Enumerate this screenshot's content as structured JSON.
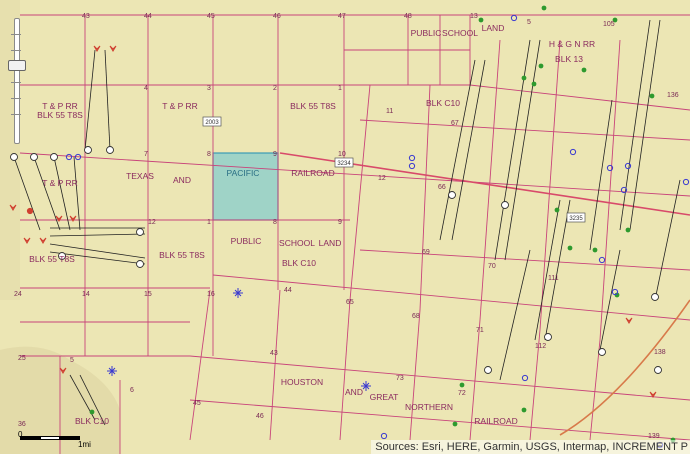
{
  "map": {
    "section_numbers": [
      "43",
      "44",
      "45",
      "46",
      "47",
      "48",
      "13",
      "5",
      "4",
      "3",
      "2",
      "1",
      "11",
      "7",
      "8",
      "9",
      "10",
      "12",
      "12",
      "1",
      "8",
      "9",
      "24",
      "14",
      "15",
      "16",
      "44",
      "25",
      "36",
      "5",
      "6",
      "43",
      "45",
      "46",
      "65",
      "73",
      "72",
      "71",
      "112",
      "111",
      "138",
      "139",
      "105",
      "136",
      "66",
      "67",
      "68",
      "69",
      "70"
    ],
    "labels": [
      "T & P RR",
      "BLK 55 T8S",
      "T & P RR",
      "BLK 55 T8S",
      "BLK C10",
      "PUBLIC",
      "SCHOOL",
      "LAND",
      "H & G N RR",
      "BLK 13",
      "TEXAS",
      "AND",
      "PACIFIC",
      "RAILROAD",
      "T & P RR",
      "BLK 55 T8S",
      "PUBLIC",
      "SCHOOL",
      "LAND",
      "BLK C10",
      "BLK 55 T8S",
      "HOUSTON",
      "AND",
      "GREAT",
      "NORTHERN",
      "RAILROAD",
      "BLK C10"
    ],
    "road_shields": [
      "2003",
      "3234",
      "3235"
    ],
    "highlighted_parcel": "PACIFIC",
    "colors": {
      "background": "#ece6b4",
      "parcel_lines": "#c8447a",
      "highlight_fill": "#9fd3c7",
      "highlight_stroke": "#3b9bb5",
      "well_green": "#2e9a2e",
      "well_blue": "#3a3ad0",
      "well_red": "#d04030"
    }
  },
  "controls": {
    "zoom_icon": "zoom-slider",
    "scale_labels": [
      "0",
      "1mi"
    ]
  },
  "attribution": "Sources: Esri, HERE, Garmin, USGS, Intermap, INCREMENT P"
}
